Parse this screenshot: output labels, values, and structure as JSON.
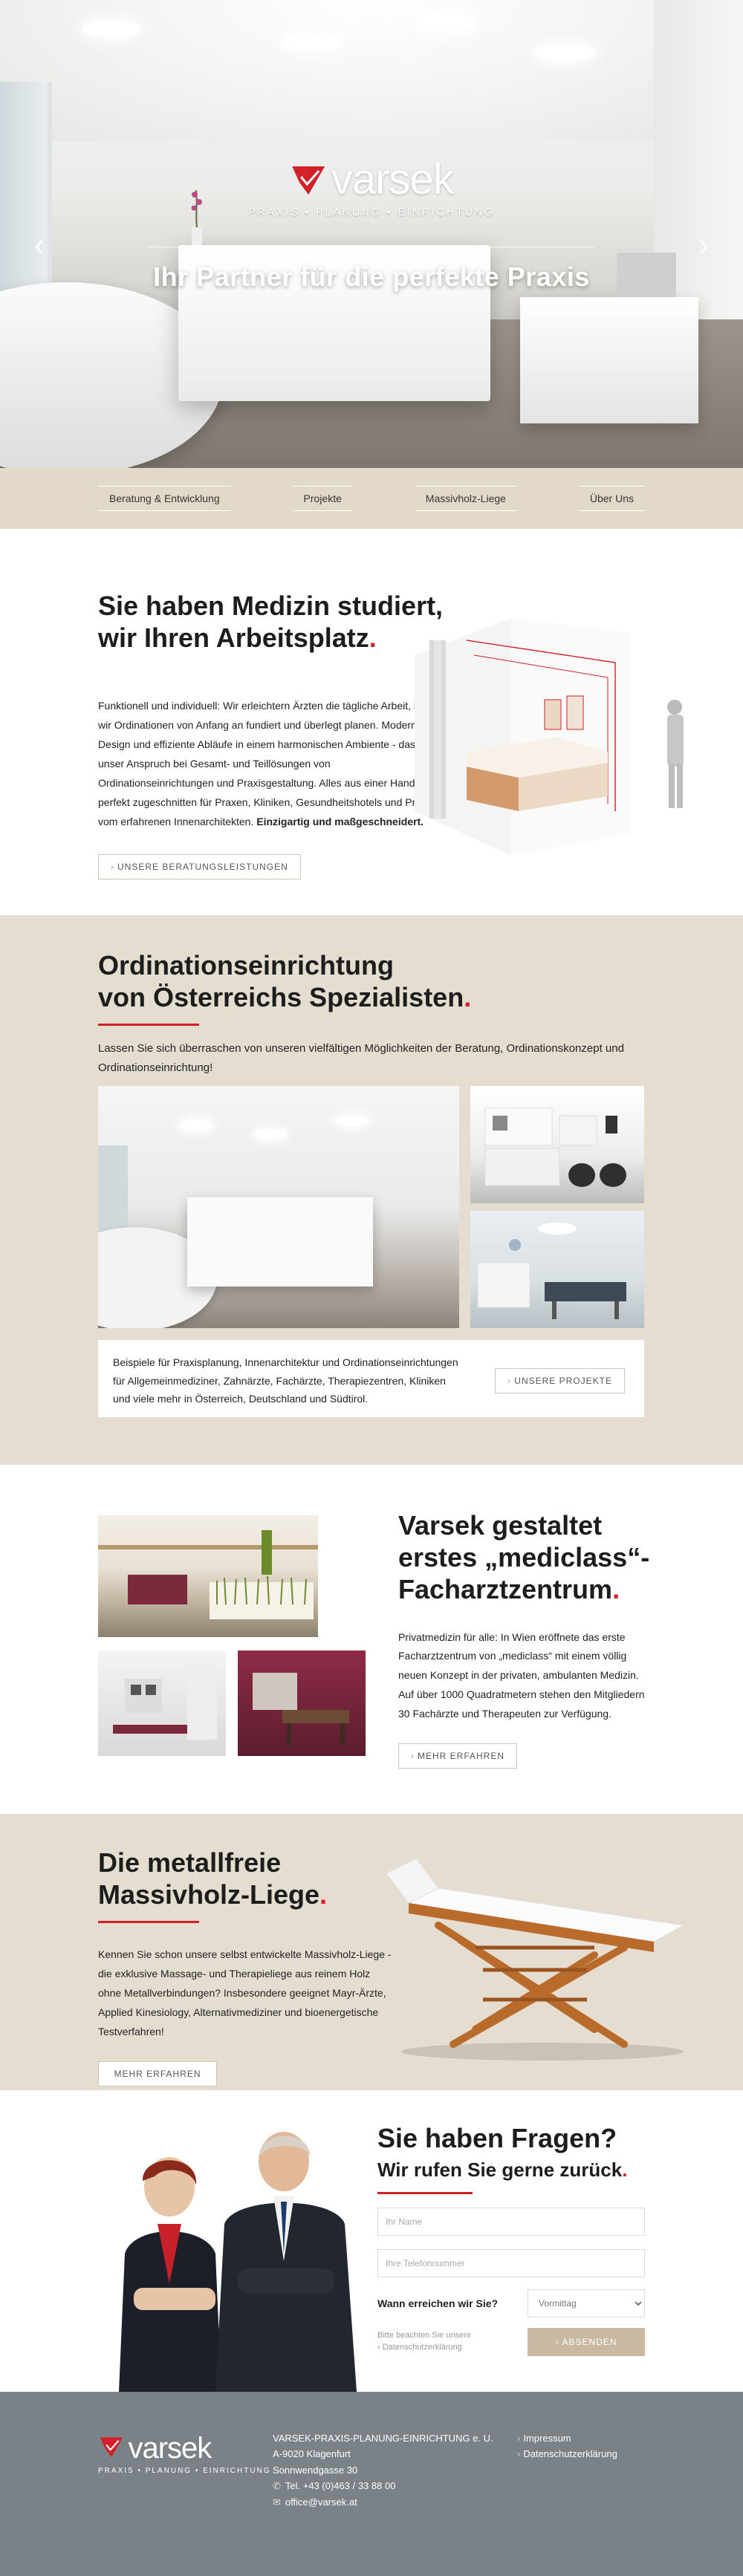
{
  "brand": {
    "name": "varsek",
    "tagline": "PRAXIS • PLANUNG • EINRICHTUNG",
    "colors": {
      "accent": "#d32028",
      "sand": "#e3d9c9",
      "sand_light": "#e6ddd1",
      "button_sand": "#c9b9a1",
      "footer": "#7a8288"
    }
  },
  "hero": {
    "title": "Ihr Partner für die perfekte Praxis",
    "arrow_left": "‹",
    "arrow_right": "›"
  },
  "nav": {
    "items": [
      {
        "label": "Beratung & Entwicklung"
      },
      {
        "label": "Projekte"
      },
      {
        "label": "Massivholz-Liege"
      },
      {
        "label": "Über Uns"
      }
    ]
  },
  "section1": {
    "heading_line1": "Sie haben Medizin studiert,",
    "heading_line2": "wir Ihren Arbeitsplatz",
    "dot": ".",
    "body": "Funktionell und individuell: Wir erleichtern Ärzten die tägliche Arbeit, indem wir Ordinationen von Anfang an fundiert und überlegt planen. Modernes Design und effiziente Abläufe in einem harmonischen Ambiente - das ist unser Anspruch bei Gesamt- und Teillösungen von Ordinationseinrichtungen und Praxisgestaltung. Alles aus einer Hand, perfekt zugeschnitten für Praxen, Kliniken, Gesundheitshotels und Private vom erfahrenen Innenarchitekten.",
    "body_bold": "Einzigartig und maßgeschneidert.",
    "button": "UNSERE BERATUNGSLEISTUNGEN"
  },
  "section2": {
    "heading_line1": "Ordinationseinrichtung",
    "heading_line2": "von Österreichs Spezialisten",
    "dot": ".",
    "intro": "Lassen Sie sich überraschen von unseren vielfältigen Möglichkeiten der Beratung, Ordinationskonzept und Ordinationseinrichtung!",
    "info": "Beispiele für Praxisplanung, Innenarchitektur und Ordinationseinrichtungen für Allgemeinmediziner, Zahnärzte, Fachärzte, Therapiezentren, Kliniken und viele mehr in Österreich, Deutschland und Südtirol.",
    "button": "UNSERE PROJEKTE"
  },
  "section3": {
    "heading_line1": "Varsek gestaltet",
    "heading_line2": "erstes „mediclass“-",
    "heading_line3": "Facharztzentrum",
    "dot": ".",
    "body": "Privatmedizin für alle: In Wien eröffnete das erste Facharztzentrum von „mediclass“ mit einem völlig neuen Konzept in der privaten, ambulanten Medizin. Auf über 1000 Quadratmetern stehen den Mitgliedern 30 Fachärzte und Therapeuten zur Verfügung.",
    "button": "MEHR ERFAHREN"
  },
  "section4": {
    "heading_line1": "Die metallfreie",
    "heading_line2": "Massivholz-Liege",
    "dot": ".",
    "body": "Kennen Sie schon unsere selbst entwickelte Massivholz-Liege - die exklusive Massage- und Therapieliege aus reinem Holz ohne Metallverbindungen? Insbesondere geeignet Mayr-Ärzte, Applied Kinesiology, Alternativmediziner und bioenergetische Testverfahren!",
    "button": "MEHR ERFAHREN"
  },
  "contact": {
    "heading": "Sie haben Fragen?",
    "subheading": "Wir rufen Sie gerne zurück",
    "dot": ".",
    "name_placeholder": "Ihr Name",
    "phone_placeholder": "Ihre Telefonnummer",
    "when_label": "Wann erreichen wir Sie?",
    "when_value": "Vormittag",
    "privacy_line1": "Bitte beachten Sie unsere",
    "privacy_line2": "› Datenschutzerklärung",
    "submit": "ABSENDEN"
  },
  "footer": {
    "company": "VARSEK-PRAXIS-PLANUNG-EINRICHTUNG e. U.",
    "city": "A-9020 Klagenfurt",
    "street": "Sonnwendgasse 30",
    "phone": "Tel. +43 (0)463 / 33 88 00",
    "email": "office@varsek.at",
    "links": [
      "Impressum",
      "Datenschutzerklärung"
    ]
  }
}
